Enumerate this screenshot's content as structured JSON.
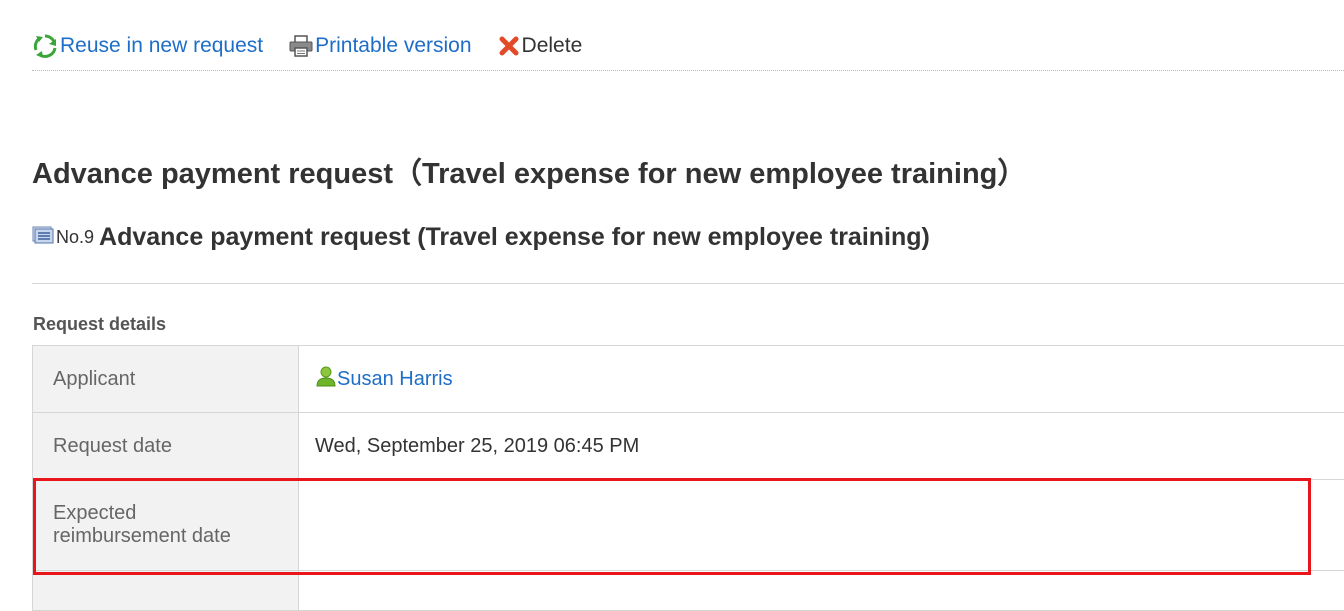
{
  "toolbar": {
    "reuse_label": "Reuse in new request",
    "print_label": "Printable version",
    "delete_label": "Delete"
  },
  "page_title": "Advance payment request（Travel expense for new employee training）",
  "request": {
    "number": "No.9",
    "name": "Advance payment request (Travel expense for new employee training)"
  },
  "details": {
    "section_title": "Request details",
    "rows": [
      {
        "label": "Applicant",
        "value": "Susan Harris"
      },
      {
        "label": "Request date",
        "value": "Wed, September 25, 2019 06:45 PM"
      },
      {
        "label_line1": "Expected",
        "label_line2": "reimbursement date",
        "value": ""
      },
      {
        "label": "",
        "value": ""
      }
    ]
  },
  "colors": {
    "link": "#1e6ec8",
    "highlight": "#e8161b",
    "label_bg": "#f2f2f2"
  }
}
